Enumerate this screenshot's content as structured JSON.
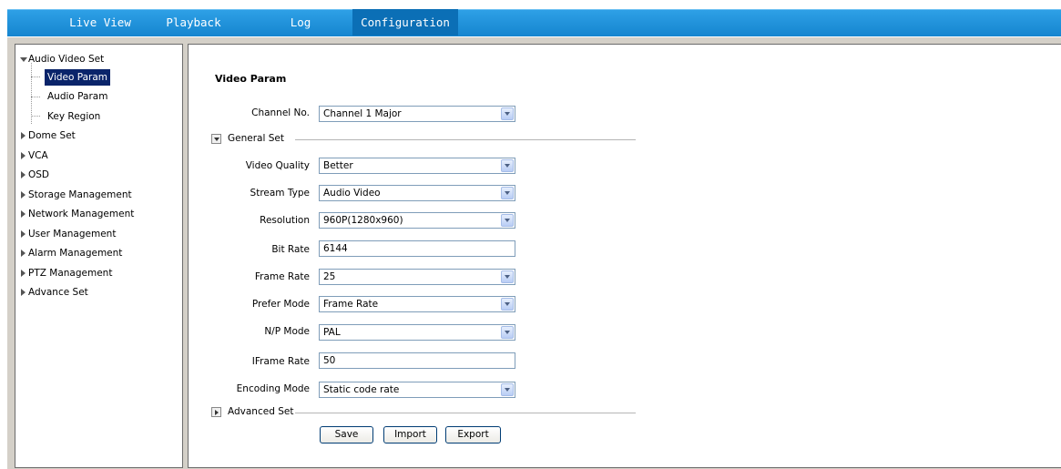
{
  "nav": {
    "tabs": [
      {
        "label": "Live View"
      },
      {
        "label": "Playback"
      },
      {
        "label": "Log"
      },
      {
        "label": "Configuration"
      }
    ],
    "active_tab": "Configuration",
    "accent_color": "#1a8ad4"
  },
  "sidebar": {
    "items": [
      {
        "label": "Audio Video Set",
        "expanded": true
      },
      {
        "label": "Video Param",
        "selected": true
      },
      {
        "label": "Audio Param"
      },
      {
        "label": "Key Region"
      },
      {
        "label": "Dome Set"
      },
      {
        "label": "VCA"
      },
      {
        "label": "OSD"
      },
      {
        "label": "Storage Management"
      },
      {
        "label": "Network Management"
      },
      {
        "label": "User Management"
      },
      {
        "label": "Alarm Management"
      },
      {
        "label": "PTZ Management"
      },
      {
        "label": "Advance Set"
      }
    ]
  },
  "main": {
    "title": "Video Param",
    "channel": {
      "label": "Channel No.",
      "value": "Channel 1 Major"
    },
    "general_set": "General Set",
    "fields": [
      {
        "label": "Video Quality",
        "value": "Better",
        "type": "select"
      },
      {
        "label": "Stream Type",
        "value": "Audio Video",
        "type": "select"
      },
      {
        "label": "Resolution",
        "value": "960P(1280x960)",
        "type": "select"
      },
      {
        "label": "Bit Rate",
        "value": "6144",
        "type": "text"
      },
      {
        "label": "Frame Rate",
        "value": "25",
        "type": "select"
      },
      {
        "label": "Prefer Mode",
        "value": "Frame Rate",
        "type": "select"
      },
      {
        "label": "N/P Mode",
        "value": "PAL",
        "type": "select"
      },
      {
        "label": "IFrame Rate",
        "value": "50",
        "type": "text"
      },
      {
        "label": "Encoding Mode",
        "value": "Static code rate",
        "type": "select"
      }
    ],
    "advanced_set": "Advanced Set",
    "buttons": {
      "save": "Save",
      "import": "Import",
      "export": "Export"
    }
  }
}
